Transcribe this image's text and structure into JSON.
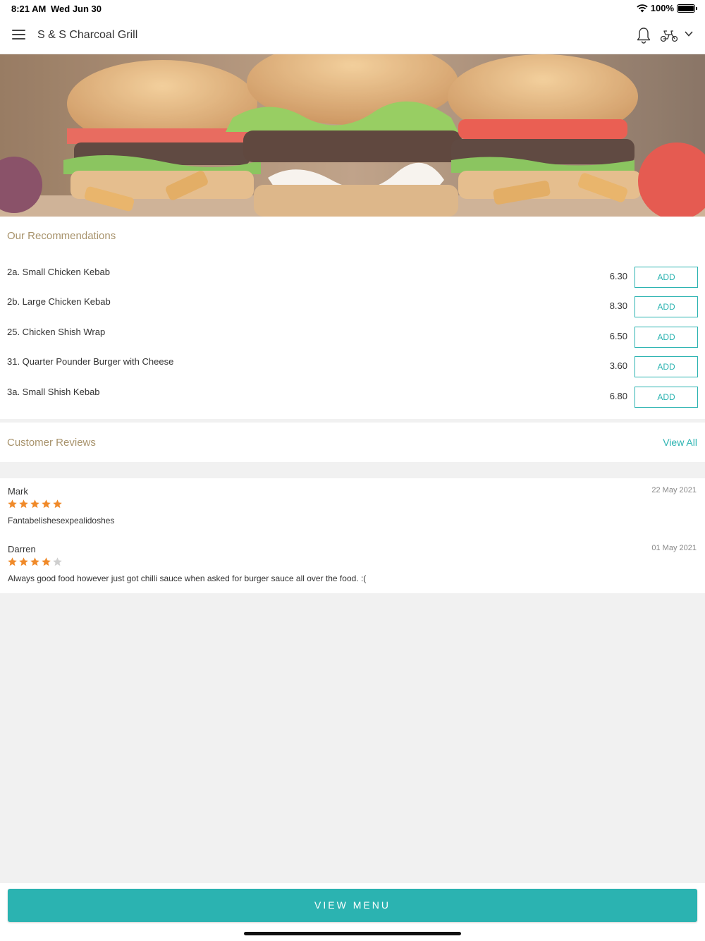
{
  "status_bar": {
    "time": "8:21 AM",
    "date": "Wed Jun 30",
    "battery": "100%"
  },
  "header": {
    "title": "S & S Charcoal Grill"
  },
  "icons": {
    "menu": "hamburger-menu-icon",
    "notifications": "bell-icon",
    "delivery": "scooter-icon",
    "dropdown": "chevron-down-icon"
  },
  "colors": {
    "accent": "#2bb3b1",
    "section_title": "#a8936c",
    "star_filled": "#f08a2a",
    "star_empty": "#cfcfcf"
  },
  "recommendations": {
    "title": "Our Recommendations",
    "items": [
      {
        "name": "2a. Small Chicken Kebab",
        "price": "6.30",
        "button": "ADD"
      },
      {
        "name": "2b. Large Chicken Kebab",
        "price": "8.30",
        "button": "ADD"
      },
      {
        "name": "25. Chicken Shish Wrap",
        "price": "6.50",
        "button": "ADD"
      },
      {
        "name": "31. Quarter Pounder Burger with Cheese",
        "price": "3.60",
        "button": "ADD"
      },
      {
        "name": "3a. Small Shish Kebab",
        "price": "6.80",
        "button": "ADD"
      }
    ]
  },
  "reviews": {
    "title": "Customer Reviews",
    "view_all": "View All",
    "items": [
      {
        "name": "Mark",
        "date": "22 May 2021",
        "rating": 5,
        "text": "Fantabelishesexpealidoshes"
      },
      {
        "name": "Darren",
        "date": "01 May 2021",
        "rating": 4,
        "text": "Always good food however just got chilli sauce when asked for burger sauce all over the food. :("
      }
    ]
  },
  "footer": {
    "button": "VIEW MENU"
  }
}
